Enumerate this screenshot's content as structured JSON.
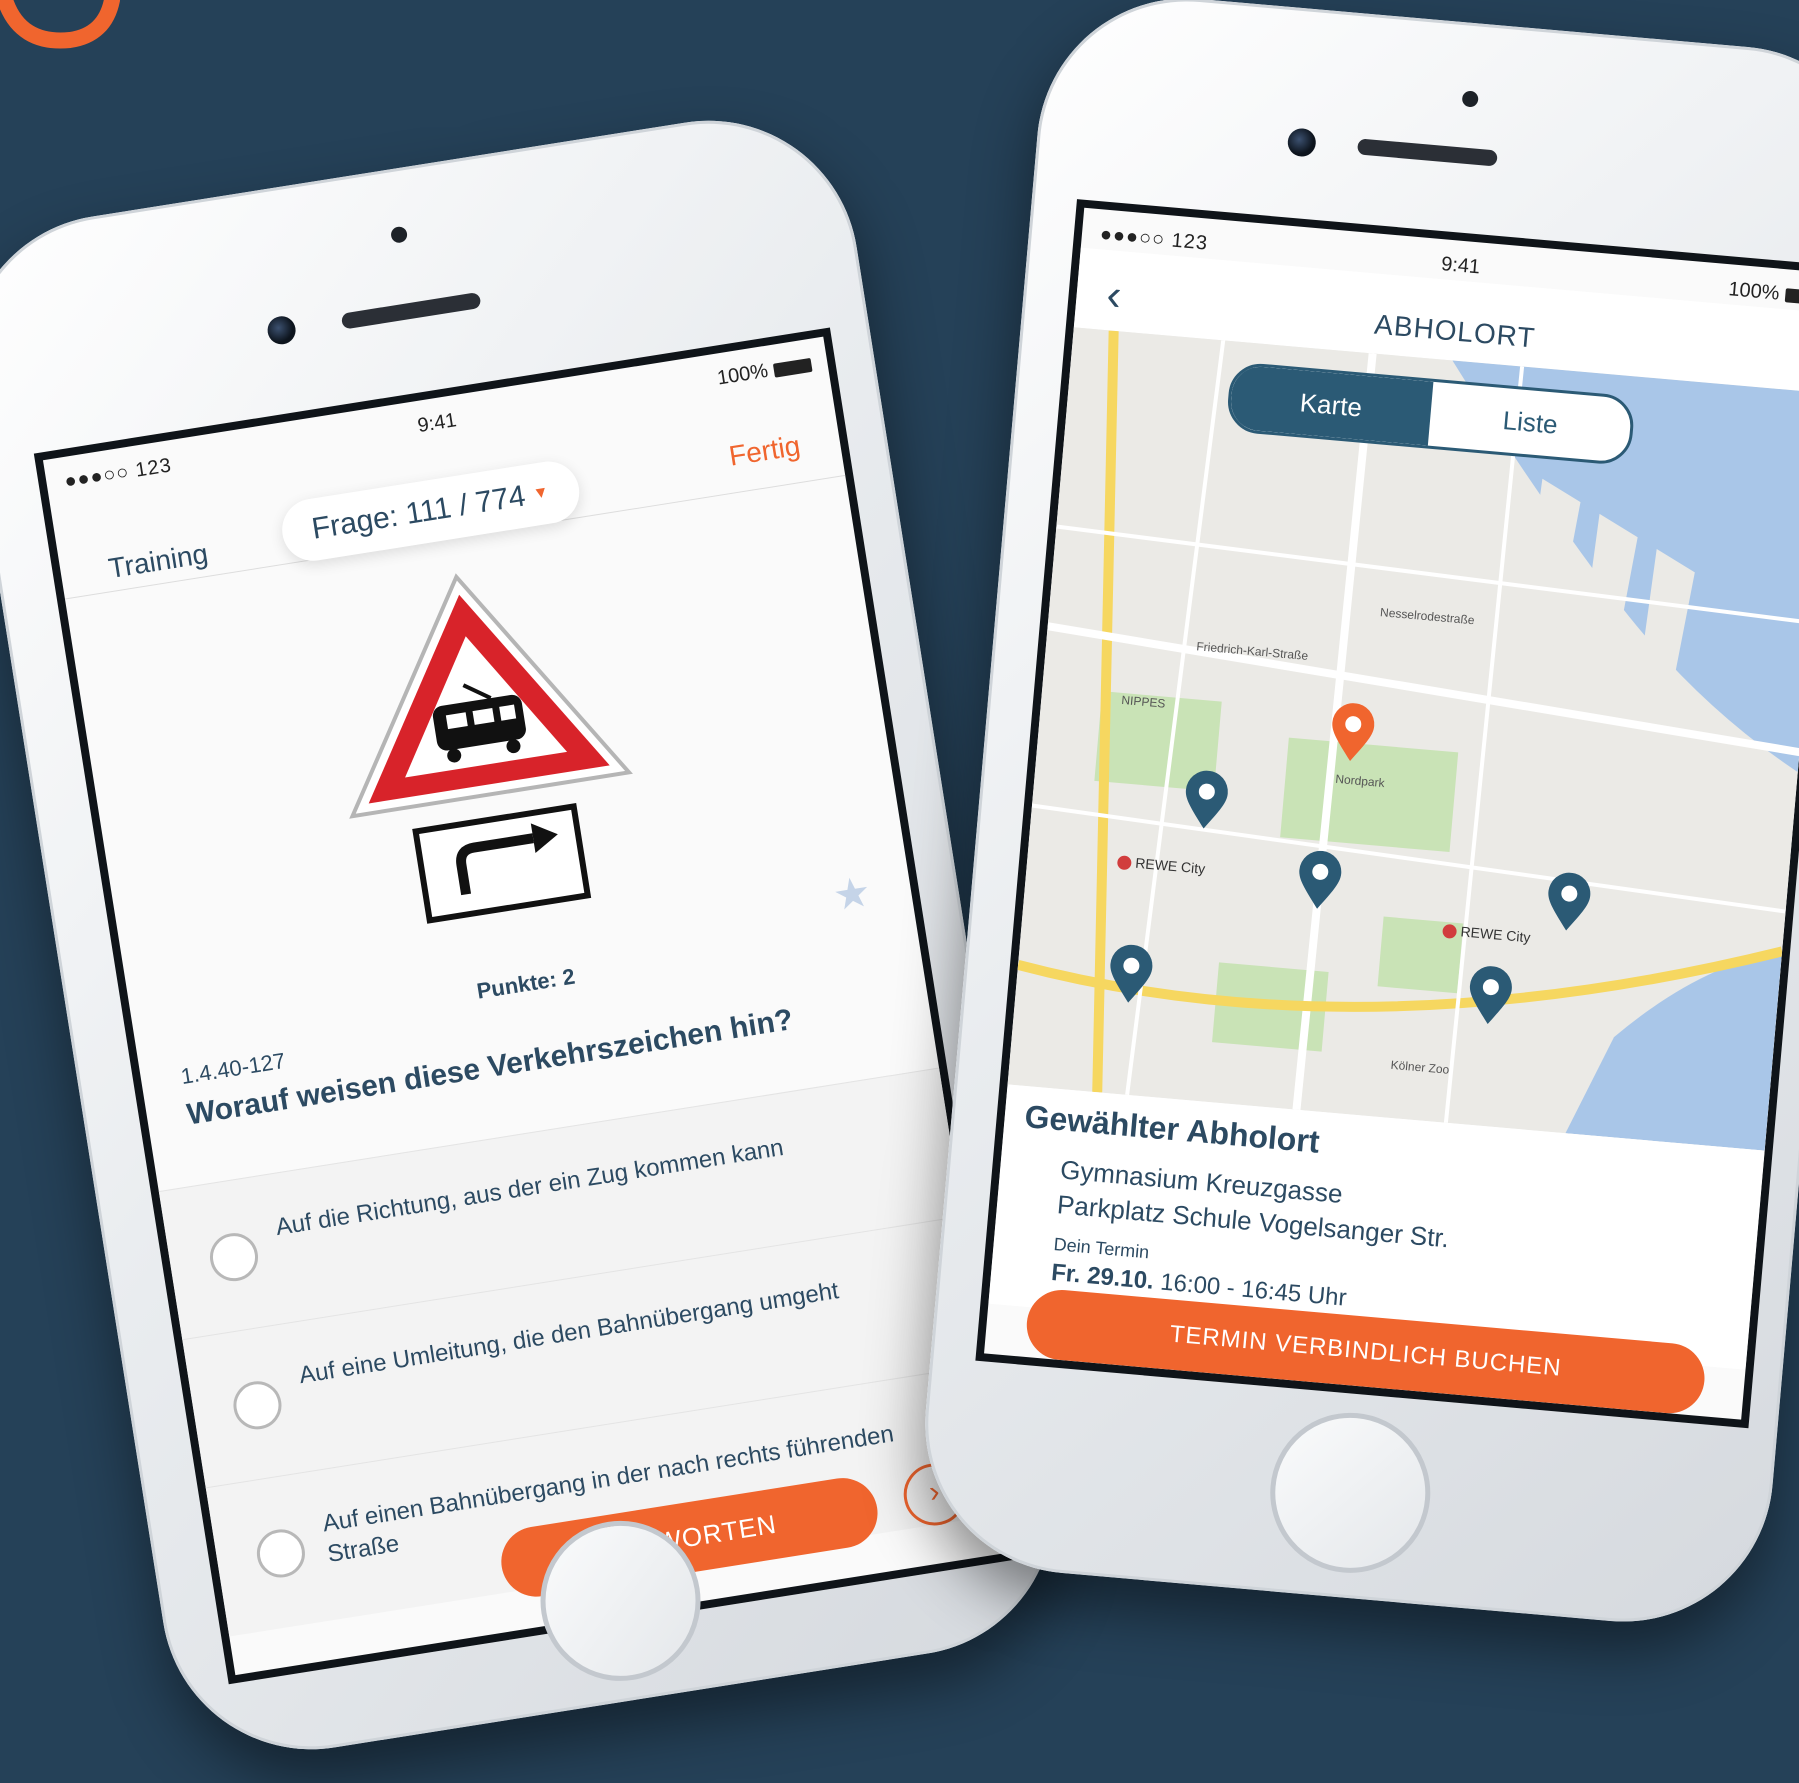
{
  "left_phone": {
    "status": {
      "signal": "●●●○○ 123",
      "time": "9:41",
      "battery": "100%"
    },
    "nav": {
      "left": "Training",
      "question_pill": "Frage: 111 / 774",
      "right": "Fertig"
    },
    "points": "Punkte: 2",
    "question_id": "1.4.40-127",
    "question": "Worauf weisen diese Verkehrszeichen hin?",
    "options": [
      "Auf die Richtung, aus der ein Zug kommen kann",
      "Auf eine Umleitung, die den Bahnübergang umgeht",
      "Auf einen Bahnübergang in der nach rechts führenden Straße"
    ],
    "answer_button": "ANTWORTEN",
    "next_icon": "›"
  },
  "right_phone": {
    "status": {
      "signal": "●●●○○ 123",
      "time": "9:41",
      "battery": "100%"
    },
    "nav": {
      "back_icon": "‹",
      "title": "ABHOLORT"
    },
    "segments": {
      "active": "Karte",
      "inactive": "Liste"
    },
    "map_labels": {
      "rewe1": "REWE City",
      "rewe2": "REWE City",
      "park": "Nordpark",
      "district": "NIPPES",
      "street": "Nesselrodestraße",
      "street2": "Friedrich-Karl-Straße",
      "zoo": "Kölner Zoo"
    },
    "selection": {
      "heading": "Gewählter Abholort",
      "line1": "Gymnasium Kreuzgasse",
      "line2": "Parkplatz Schule Vogelsanger Str.",
      "term_label": "Dein Termin",
      "term_date": "Fr. 29.10.",
      "term_time": "16:00 - 16:45 Uhr"
    },
    "book_button": "TERMIN VERBINDLICH BUCHEN"
  },
  "colors": {
    "accent": "#f0652e",
    "navy": "#2c4a62",
    "background": "#254158"
  }
}
